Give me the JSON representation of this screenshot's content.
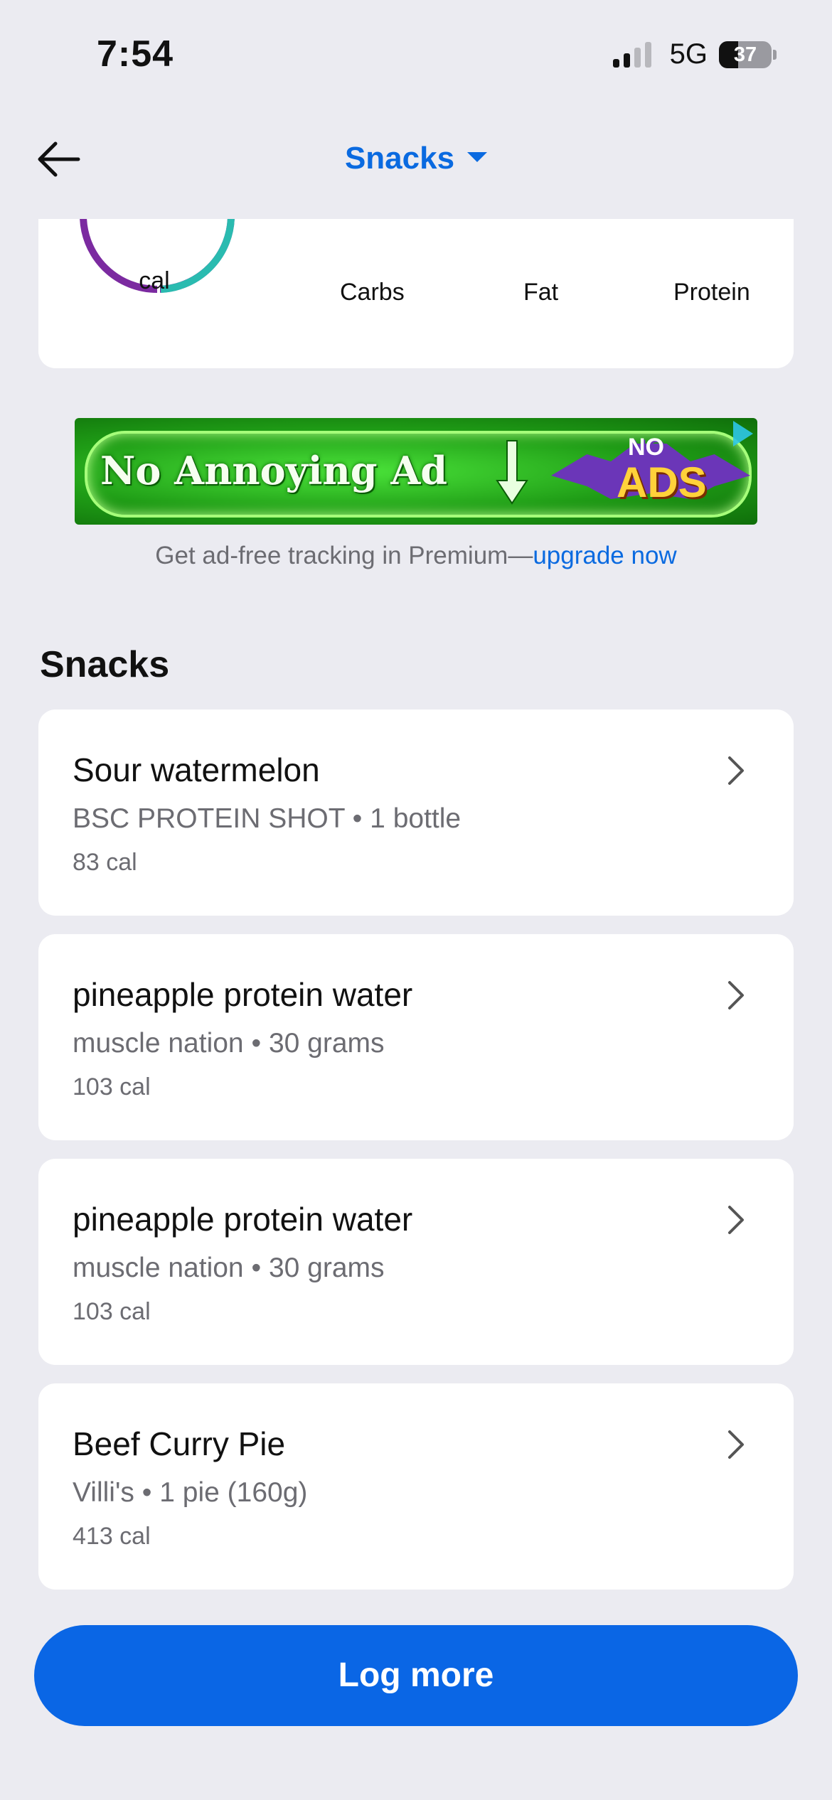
{
  "status_bar": {
    "time": "7:54",
    "network": "5G",
    "battery": "37"
  },
  "header": {
    "title": "Snacks"
  },
  "summary": {
    "ring_label": "cal",
    "macros": [
      "Carbs",
      "Fat",
      "Protein"
    ],
    "ring_colors": {
      "carbs": "#2abbb0",
      "fat": "#7b2aa0"
    }
  },
  "ad": {
    "text": "No Annoying Ad",
    "badge_top": "NO",
    "badge_bottom": "ADS"
  },
  "upsell": {
    "text": "Get ad-free tracking in Premium—",
    "link": "upgrade now"
  },
  "section": {
    "title": "Snacks"
  },
  "foods": [
    {
      "name": "Sour watermelon",
      "brand": "BSC PROTEIN SHOT",
      "serving": "1 bottle",
      "cal": "83 cal"
    },
    {
      "name": "pineapple protein water",
      "brand": "muscle nation",
      "serving": "30 grams",
      "cal": "103 cal"
    },
    {
      "name": "pineapple protein water",
      "brand": "muscle nation",
      "serving": "30 grams",
      "cal": "103 cal"
    },
    {
      "name": "Beef Curry Pie",
      "brand": "Villi's",
      "serving": "1 pie (160g)",
      "cal": "413 cal"
    }
  ],
  "actions": {
    "log_more": "Log more"
  },
  "colors": {
    "accent": "#0a6ae0",
    "background": "#ebebf1"
  }
}
